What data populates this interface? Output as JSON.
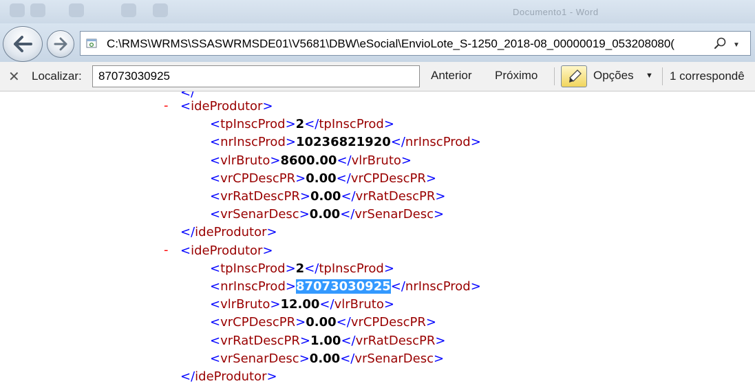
{
  "title_bar": {
    "text": "Documento1 - Word"
  },
  "address_bar": {
    "url": "C:\\RMS\\WRMS\\SSASWRMSDE01\\V5681\\DBW\\eSocial\\EnvioLote_S-1250_2018-08_00000019_053208080("
  },
  "find_bar": {
    "close_symbol": "✕",
    "label": "Localizar:",
    "query": "87073030925",
    "prev_label": "Anterior",
    "next_label": "Próximo",
    "options_label": "Opções",
    "match_count": "1 correspondê"
  },
  "xml": {
    "minus": "-",
    "blocks": [
      {
        "open_tag": "ideProdutor",
        "close_tag": "ideProdutor",
        "fields": [
          {
            "tag": "tpInscProd",
            "value": "2"
          },
          {
            "tag": "nrInscProd",
            "value": "10236821920"
          },
          {
            "tag": "vlrBruto",
            "value": "8600.00"
          },
          {
            "tag": "vrCPDescPR",
            "value": "0.00"
          },
          {
            "tag": "vrRatDescPR",
            "value": "0.00"
          },
          {
            "tag": "vrSenarDesc",
            "value": "0.00"
          }
        ]
      },
      {
        "open_tag": "ideProdutor",
        "close_tag": "ideProdutor",
        "fields": [
          {
            "tag": "tpInscProd",
            "value": "2"
          },
          {
            "tag": "nrInscProd",
            "value": "87073030925",
            "highlighted": true
          },
          {
            "tag": "vlrBruto",
            "value": "12.00"
          },
          {
            "tag": "vrCPDescPR",
            "value": "0.00"
          },
          {
            "tag": "vrRatDescPR",
            "value": "1.00"
          },
          {
            "tag": "vrSenarDesc",
            "value": "0.00"
          }
        ]
      }
    ]
  },
  "colors": {
    "bracket": "#0000ff",
    "tag_name": "#990000",
    "value": "#000000",
    "minus": "#ff0000",
    "highlight": "#3399ff"
  },
  "icons": [
    "back-arrow-icon",
    "forward-arrow-icon",
    "page-icon",
    "search-icon",
    "chevron-down-icon",
    "close-icon",
    "highlighter-icon"
  ]
}
